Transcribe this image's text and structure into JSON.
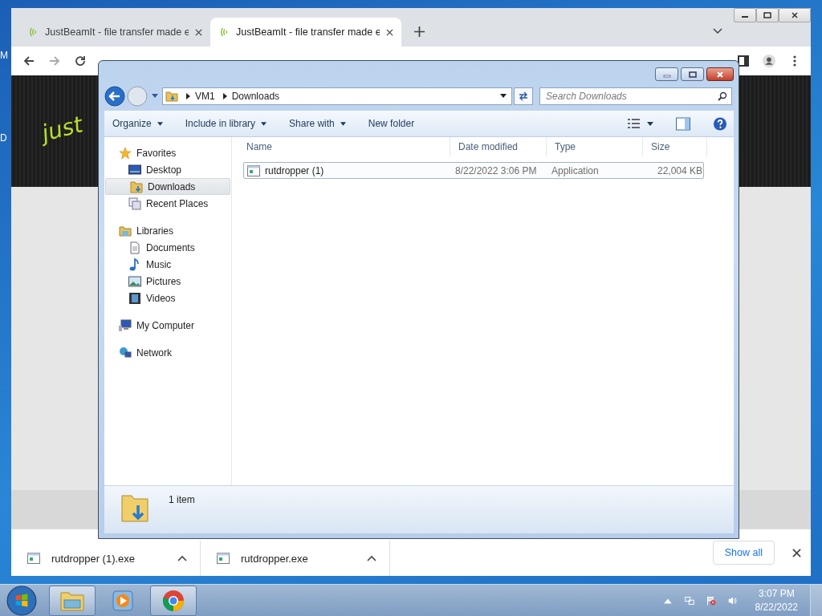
{
  "desktop": {
    "icon_labels": [
      "M",
      "D"
    ]
  },
  "browser": {
    "tabs": [
      {
        "title": "JustBeamIt - file transfer made e",
        "selected": false
      },
      {
        "title": "JustBeamIt - file transfer made e",
        "selected": true
      }
    ],
    "page": {
      "logo_text": "just"
    },
    "downloads": [
      {
        "name": "rutdropper (1).exe"
      },
      {
        "name": "rutdropper.exe"
      }
    ],
    "show_all": "Show all"
  },
  "explorer": {
    "breadcrumb": [
      "VM1",
      "Downloads"
    ],
    "search": {
      "placeholder": "Search Downloads"
    },
    "toolbar": [
      {
        "label": "Organize",
        "menu": true
      },
      {
        "label": "Include in library",
        "menu": true
      },
      {
        "label": "Share with",
        "menu": true
      },
      {
        "label": "New folder",
        "menu": false
      }
    ],
    "nav": [
      {
        "label": "Favorites",
        "kind": "star",
        "selected": false,
        "children": [
          {
            "label": "Desktop",
            "kind": "desktop",
            "selected": false
          },
          {
            "label": "Downloads",
            "kind": "downloads",
            "selected": true
          },
          {
            "label": "Recent Places",
            "kind": "recent",
            "selected": false
          }
        ]
      },
      {
        "label": "Libraries",
        "kind": "library",
        "selected": false,
        "children": [
          {
            "label": "Documents",
            "kind": "document",
            "selected": false
          },
          {
            "label": "Music",
            "kind": "music",
            "selected": false
          },
          {
            "label": "Pictures",
            "kind": "pictures",
            "selected": false
          },
          {
            "label": "Videos",
            "kind": "videos",
            "selected": false
          }
        ]
      },
      {
        "label": "My Computer",
        "kind": "computer",
        "selected": false
      },
      {
        "label": "Network",
        "kind": "network",
        "selected": false
      }
    ],
    "columns": [
      "Name",
      "Date modified",
      "Type",
      "Size"
    ],
    "files": [
      {
        "name": "rutdropper (1)",
        "date": "8/22/2022 3:06 PM",
        "type": "Application",
        "size": "22,004 KB",
        "selected": true
      }
    ],
    "status": "1 item"
  },
  "taskbar": {
    "apps": [
      {
        "kind": "explorer",
        "running": true
      },
      {
        "kind": "media",
        "running": false
      },
      {
        "kind": "chrome",
        "running": true
      }
    ],
    "clock": {
      "time": "3:07 PM",
      "date": "8/22/2022"
    }
  }
}
